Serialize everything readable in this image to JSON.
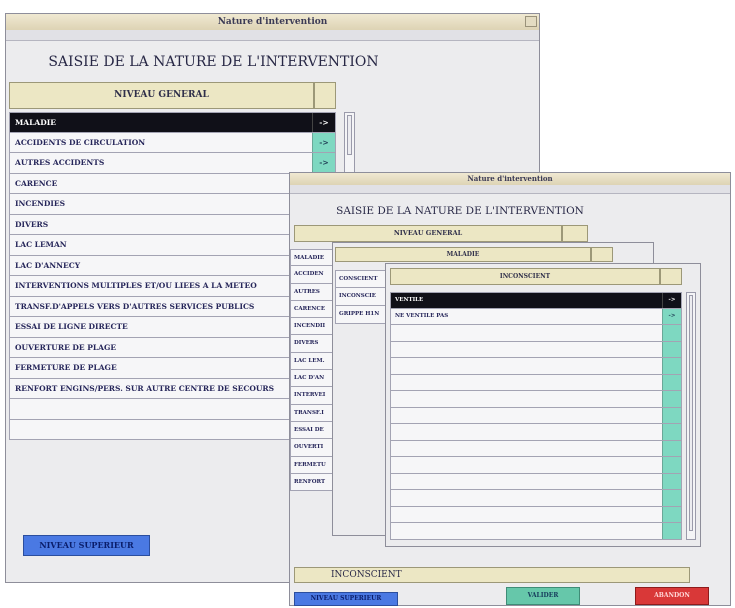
{
  "back_window": {
    "title": "Nature d'intervention",
    "heading": "SAISIE DE LA NATURE DE L'INTERVENTION",
    "level_header": "NIVEAU GENERAL",
    "items": [
      {
        "label": "MALADIE",
        "arrow": "->"
      },
      {
        "label": "ACCIDENTS DE CIRCULATION",
        "arrow": "->"
      },
      {
        "label": "AUTRES ACCIDENTS",
        "arrow": "->"
      },
      {
        "label": "CARENCE",
        "arrow": ""
      },
      {
        "label": "INCENDIES",
        "arrow": ""
      },
      {
        "label": "DIVERS",
        "arrow": ""
      },
      {
        "label": "LAC LEMAN",
        "arrow": ""
      },
      {
        "label": "LAC D'ANNECY",
        "arrow": ""
      },
      {
        "label": "INTERVENTIONS MULTIPLES ET/OU LIEES A LA METEO",
        "arrow": ""
      },
      {
        "label": "TRANSF.D'APPELS VERS D'AUTRES SERVICES PUBLICS",
        "arrow": ""
      },
      {
        "label": "ESSAI DE LIGNE DIRECTE",
        "arrow": ""
      },
      {
        "label": "OUVERTURE DE PLAGE",
        "arrow": ""
      },
      {
        "label": "FERMETURE DE PLAGE",
        "arrow": ""
      },
      {
        "label": "RENFORT ENGINS/PERS. SUR AUTRE CENTRE DE SECOURS",
        "arrow": ""
      }
    ],
    "button_upper": "NIVEAU SUPERIEUR"
  },
  "front_window": {
    "title": "Nature d'intervention",
    "heading": "SAISIE DE LA NATURE DE L'INTERVENTION",
    "level_header": "NIVEAU GENERAL",
    "items": [
      "MALADIE",
      "ACCIDEN",
      "AUTRES",
      "CARENCE",
      "INCENDII",
      "DIVERS",
      "LAC LEM.",
      "LAC D'AN",
      "INTERVEI",
      "TRANSF.I",
      "ESSAI DE",
      "OUVERTI",
      "FERMETU",
      "RENFORT"
    ],
    "maladie_panel": {
      "header": "MALADIE",
      "items": [
        "CONSCIENT",
        "INCONSCIE",
        "GRIPPE H1N"
      ]
    },
    "inconscient_panel": {
      "header": "INCONSCIENT",
      "items": [
        {
          "label": "VENTILE",
          "arrow": "->"
        },
        {
          "label": "NE VENTILE PAS",
          "arrow": "->"
        }
      ]
    },
    "selection_field": "INCONSCIENT",
    "buttons": {
      "upper": "NIVEAU SUPERIEUR",
      "validate": "VALIDER",
      "abandon": "ABANDON"
    }
  }
}
